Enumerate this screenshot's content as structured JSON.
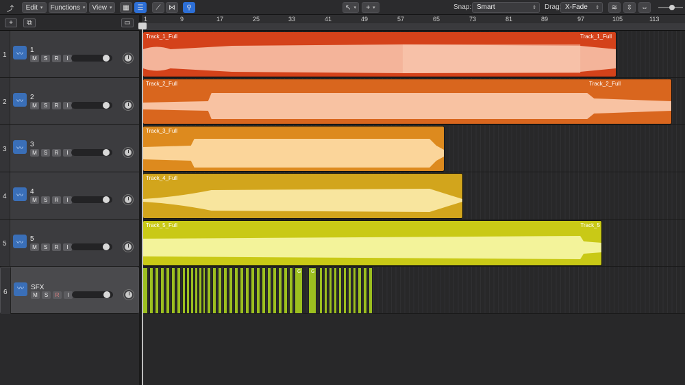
{
  "toolbar": {
    "edit": "Edit",
    "functions": "Functions",
    "view": "View",
    "snap_label": "Snap:",
    "snap_value": "Smart",
    "drag_label": "Drag:",
    "drag_value": "X-Fade"
  },
  "header": {
    "add_track": "+"
  },
  "ruler": {
    "bars": [
      "1",
      "9",
      "17",
      "25",
      "33",
      "41",
      "49",
      "57",
      "65",
      "73",
      "81",
      "89",
      "97",
      "105",
      "113"
    ]
  },
  "tracks": [
    {
      "number": "1",
      "name": "1"
    },
    {
      "number": "2",
      "name": "2"
    },
    {
      "number": "3",
      "name": "3"
    },
    {
      "number": "4",
      "name": "4"
    },
    {
      "number": "5",
      "name": "5"
    },
    {
      "number": "6",
      "name": "SFX"
    }
  ],
  "track_buttons": {
    "m": "M",
    "s": "S",
    "r": "R",
    "i": "I"
  },
  "regions": [
    {
      "name": "Track_1_Full",
      "end_name": "Track_1_Full",
      "color": "#d4421a"
    },
    {
      "name": "Track_2_Full",
      "end_name": "Track_2_Full",
      "color": "#d9661e"
    },
    {
      "name": "Track_3_Full",
      "color": "#dd8a1e"
    },
    {
      "name": "Track_4_Full",
      "color": "#d2a51c"
    },
    {
      "name": "Track_5_Full",
      "end_name": "Track_5",
      "color": "#c9c916"
    }
  ],
  "sfx": {
    "color": "#9cbf1f",
    "group_marker": "G"
  }
}
